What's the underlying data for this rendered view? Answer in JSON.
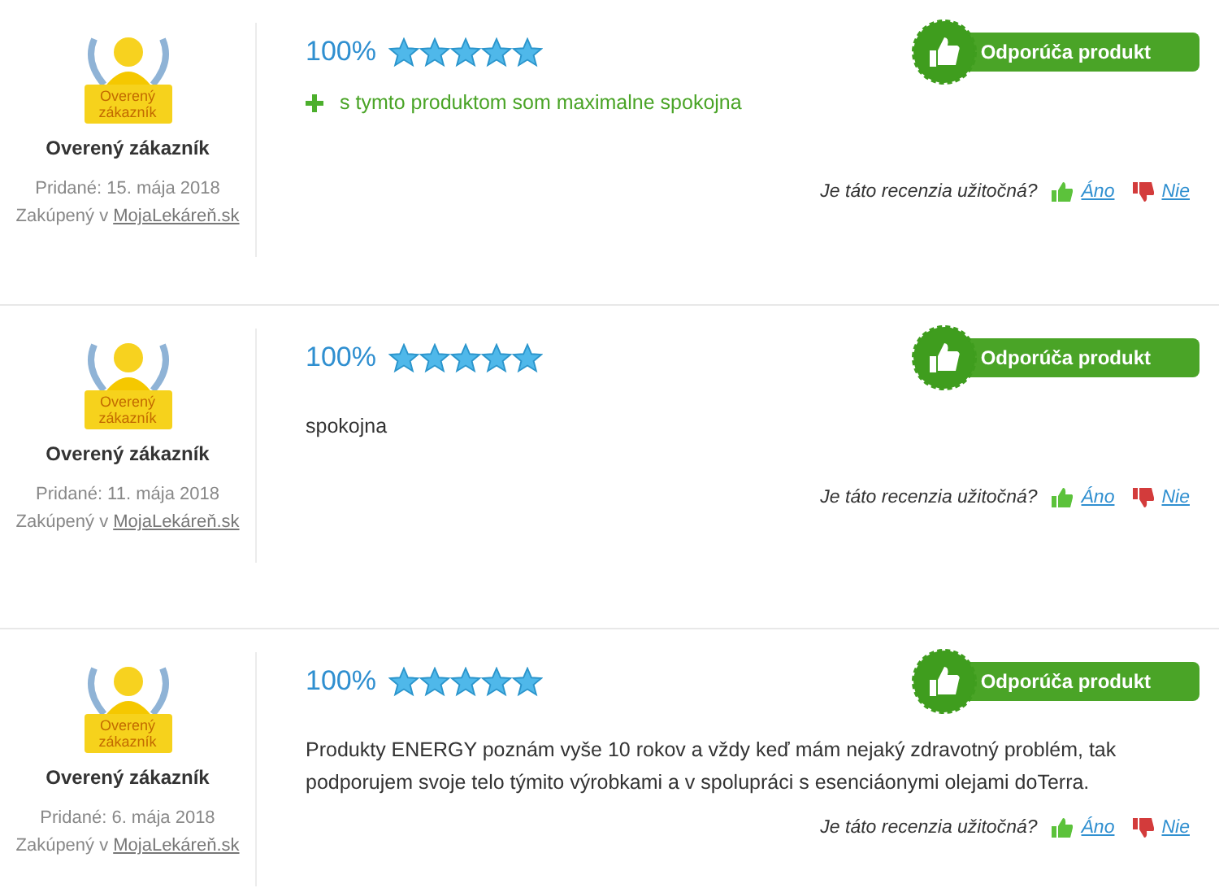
{
  "reviews": [
    {
      "badge_text": "Overený zákazník",
      "author": "Overený zákazník",
      "added": "Pridané: 15. mája 2018",
      "purchased_prefix": "Zakúpený v",
      "shop": "MojaLekáreň.sk",
      "percent": "100%",
      "stars": 5,
      "recommend": "Odporúča produkt",
      "body": {
        "kind": "pro",
        "text": "s tymto produktom som maximalne spokojna"
      },
      "helpful_question": "Je táto recenzia užitočná?",
      "yes": "Áno",
      "no": "Nie"
    },
    {
      "badge_text": "Overený zákazník",
      "author": "Overený zákazník",
      "added": "Pridané: 11. mája 2018",
      "purchased_prefix": "Zakúpený v",
      "shop": "MojaLekáreň.sk",
      "percent": "100%",
      "stars": 5,
      "recommend": "Odporúča produkt",
      "body": {
        "kind": "text",
        "text": "spokojna"
      },
      "helpful_question": "Je táto recenzia užitočná?",
      "yes": "Áno",
      "no": "Nie"
    },
    {
      "badge_text": "Overený zákazník",
      "author": "Overený zákazník",
      "added": "Pridané: 6. mája 2018",
      "purchased_prefix": "Zakúpený v",
      "shop": "MojaLekáreň.sk",
      "percent": "100%",
      "stars": 5,
      "recommend": "Odporúča produkt",
      "body": {
        "kind": "text",
        "text": "Produkty ENERGY poznám vyše 10 rokov a vždy keď mám nejaký zdravotný problém, tak podporujem svoje telo týmito výrobkami a v spolupráci s esenciáonymi olejami doTerra."
      },
      "helpful_question": "Je táto recenzia užitočná?",
      "yes": "Áno",
      "no": "Nie"
    }
  ]
}
